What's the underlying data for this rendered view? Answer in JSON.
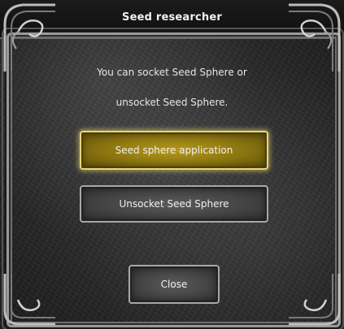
{
  "window": {
    "title": "Seed researcher"
  },
  "dialog": {
    "message_line1": "You can socket Seed Sphere or",
    "message_line2": "unsocket Seed Sphere."
  },
  "buttons": {
    "apply_label": "Seed sphere application",
    "unsocket_label": "Unsocket Seed Sphere",
    "close_label": "Close"
  },
  "colors": {
    "highlight_button": "#b59a1c",
    "highlight_border": "#e8d77a",
    "stone_bg": "#2e2e2e",
    "text": "#f0f0f0"
  },
  "icons": {
    "corner_ornament": "scroll-ornament-icon"
  }
}
